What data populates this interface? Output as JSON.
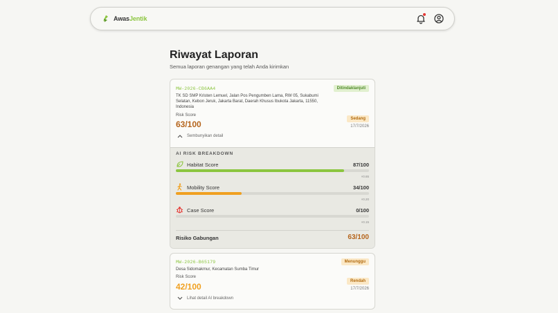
{
  "brand": {
    "part1": "Awas",
    "part2": "Jentik"
  },
  "header": {
    "title": "Riwayat Laporan",
    "subtitle": "Semua laporan genangan yang telah Anda kirimkan"
  },
  "reports": [
    {
      "id": "MW-2026-CB6AA4",
      "address": "TK SD SMP Kristen Lemuel, Jalan Pos Pengumben Lama, RW 05, Sukabumi Selatan, Kebon Jeruk, Jakarta Barat, Daerah Khusus Ibukota Jakarta, 11550, Indonesia",
      "status": "Ditindaklanjuti",
      "risk_label": "Risk Score",
      "risk_score": "63/100",
      "level": "Sedang",
      "date": "17/7/2026",
      "toggle": "Sembunyikan detail",
      "breakdown": {
        "title": "AI RISK BREAKDOWN",
        "metrics": [
          {
            "label": "Habitat Score",
            "value": "87/100",
            "pct": 87,
            "weight": "×0.65",
            "color": "#8bc53f"
          },
          {
            "label": "Mobility Score",
            "value": "34/100",
            "pct": 34,
            "weight": "×0.20",
            "color": "#f0a020"
          },
          {
            "label": "Case Score",
            "value": "0/100",
            "pct": 0,
            "weight": "×0.15",
            "color": "#e53935"
          }
        ],
        "combined_label": "Risiko Gabungan",
        "combined_value": "63/100"
      }
    },
    {
      "id": "MW-2026-B65179",
      "address": "Desa Sidomakmur, Kecamatan Sumba Timur",
      "status": "Menunggu",
      "risk_label": "Risk Score",
      "risk_score": "42/100",
      "level": "Rendah",
      "date": "17/7/2026",
      "toggle": "Lihat detail AI breakdown"
    }
  ],
  "colors": {
    "accent": "#8bc53f",
    "amber": "#f0a020",
    "brown": "#b5651d"
  }
}
